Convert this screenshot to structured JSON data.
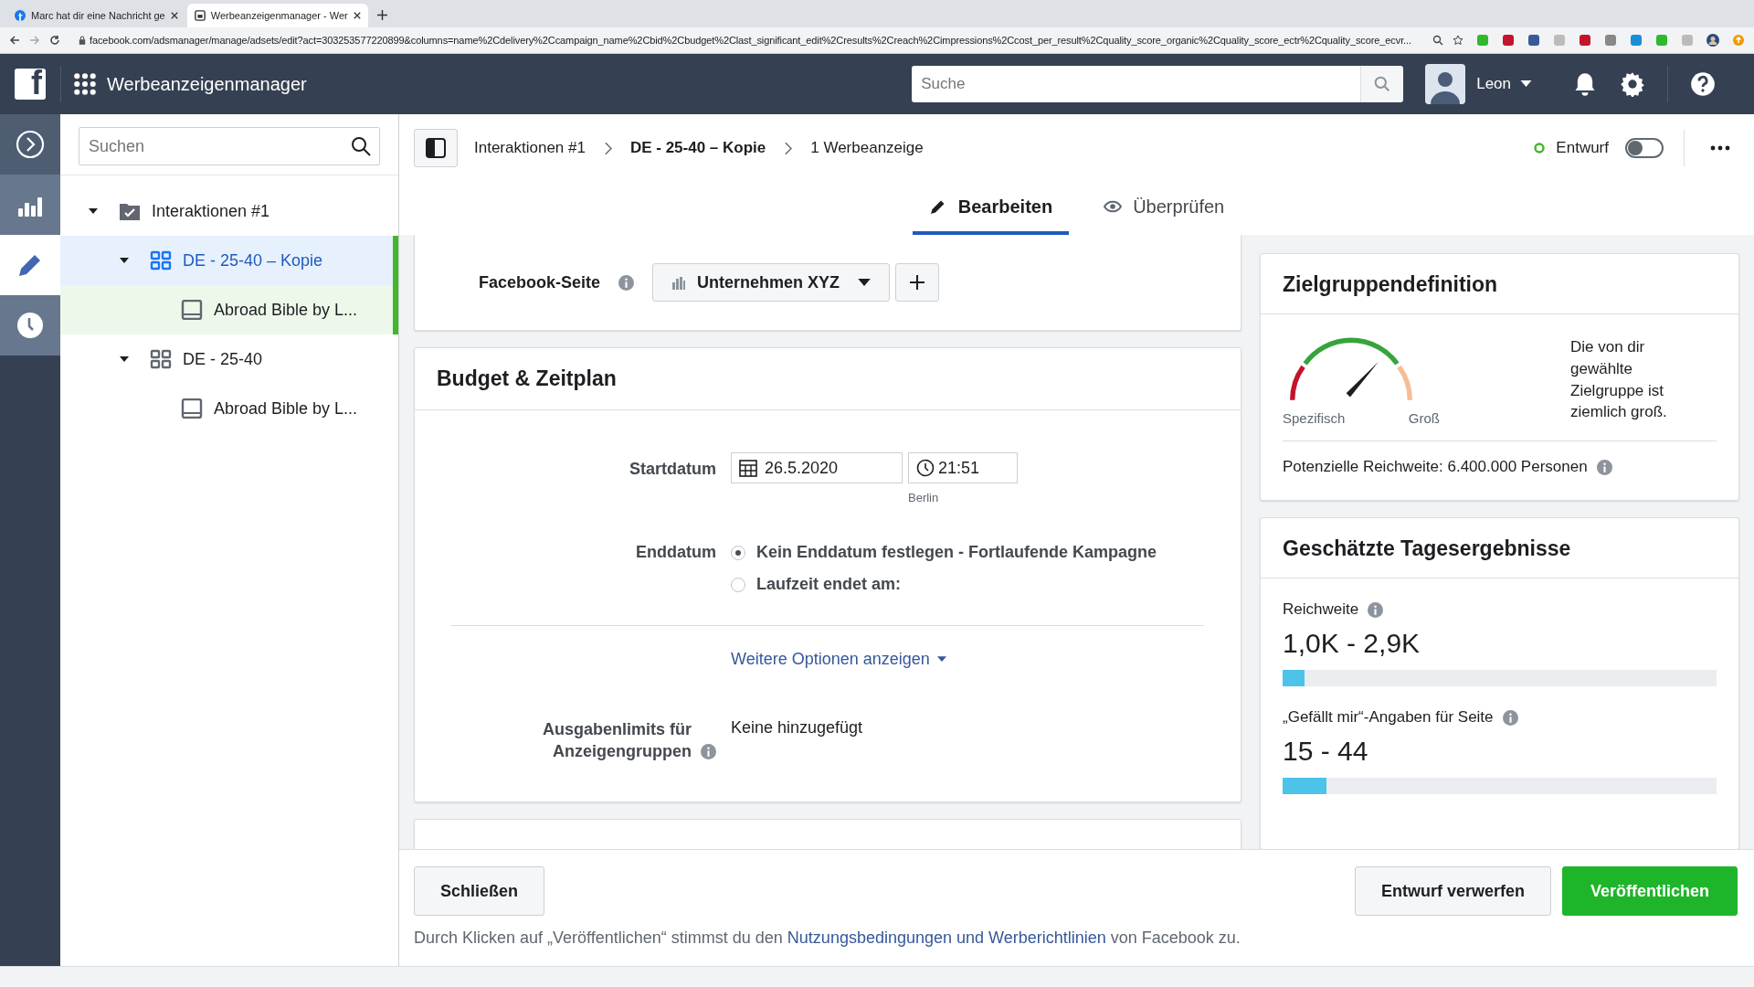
{
  "browser": {
    "tabs": [
      {
        "title": "Marc hat dir eine Nachricht ge",
        "selected": false
      },
      {
        "title": "Werbeanzeigenmanager - Wer",
        "selected": true
      }
    ],
    "url": "facebook.com/adsmanager/manage/adsets/edit?act=303253577220899&columns=name%2Cdelivery%2Ccampaign_name%2Cbid%2Cbudget%2Clast_significant_edit%2Cresults%2Creach%2Cimpressions%2Ccost_per_result%2Cquality_score_organic%2Cquality_score_ectr%2Cquality_score_ecvr..."
  },
  "header": {
    "logo": "f",
    "app_title": "Werbeanzeigenmanager",
    "search_placeholder": "Suche",
    "user": "Leon"
  },
  "rail": [
    {
      "kind": "expand",
      "selected": false
    },
    {
      "kind": "reports",
      "selected": false
    },
    {
      "kind": "edit",
      "selected": true
    },
    {
      "kind": "history",
      "selected": false
    }
  ],
  "tree": {
    "search_placeholder": "Suchen",
    "items": [
      {
        "label": "Interaktionen #1",
        "kind": "campaign",
        "expanded": true,
        "selected": false,
        "children": [
          {
            "label": "DE - 25-40 – Kopie",
            "kind": "adset",
            "expanded": true,
            "selected": true,
            "children": [
              {
                "label": "Abroad Bible by L...",
                "kind": "ad",
                "selected": false,
                "in_selection": true
              }
            ]
          },
          {
            "label": "DE - 25-40",
            "kind": "adset",
            "expanded": true,
            "selected": false,
            "children": [
              {
                "label": "Abroad Bible by L...",
                "kind": "ad",
                "selected": false,
                "in_selection": false
              }
            ]
          }
        ]
      }
    ]
  },
  "breadcrumb": [
    "Interaktionen #1",
    "DE - 25-40 – Kopie",
    "1 Werbeanzeige"
  ],
  "status": {
    "label": "Entwurf",
    "on": false
  },
  "tabs": [
    {
      "label": "Bearbeiten",
      "kind": "edit",
      "selected": true
    },
    {
      "label": "Überprüfen",
      "kind": "review",
      "selected": false
    }
  ],
  "facebook_page": {
    "label": "Facebook-Seite",
    "value": "Unternehmen XYZ"
  },
  "budget": {
    "title": "Budget & Zeitplan",
    "start_label": "Startdatum",
    "date": "26.5.2020",
    "time": "21:51",
    "timezone": "Berlin",
    "end_label": "Enddatum",
    "end_options": [
      {
        "label": "Kein Enddatum festlegen - Fortlaufende Kampagne",
        "selected": true
      },
      {
        "label": "Laufzeit endet am:",
        "selected": false
      }
    ],
    "more_link": "Weitere Optionen anzeigen",
    "limits_label": "Ausgabenlimits für Anzeigengruppen",
    "limits_value": "Keine hinzugefügt"
  },
  "audience": {
    "title": "Zielgruppendefinition",
    "gauge_min": "Spezifisch",
    "gauge_max": "Groß",
    "description": "Die von dir gewählte Zielgruppe ist ziemlich groß.",
    "reach": "Potenzielle Reichweite: 6.400.000 Personen"
  },
  "estimates": {
    "title": "Geschätzte Tagesergebnisse",
    "metrics": [
      {
        "label": "Reichweite",
        "value": "1,0K - 2,9K",
        "level": 0.05
      },
      {
        "label": "„Gefällt mir“-Angaben für Seite",
        "value": "15 - 44",
        "level": 0.1
      }
    ]
  },
  "footer": {
    "close": "Schließen",
    "discard": "Entwurf verwerfen",
    "publish": "Veröffentlichen",
    "legal_before": "Durch Klicken auf „Veröffentlichen“ stimmst du den",
    "legal_link": "Nutzungsbedingungen und Werberichtlinien",
    "legal_after": "von Facebook zu."
  }
}
